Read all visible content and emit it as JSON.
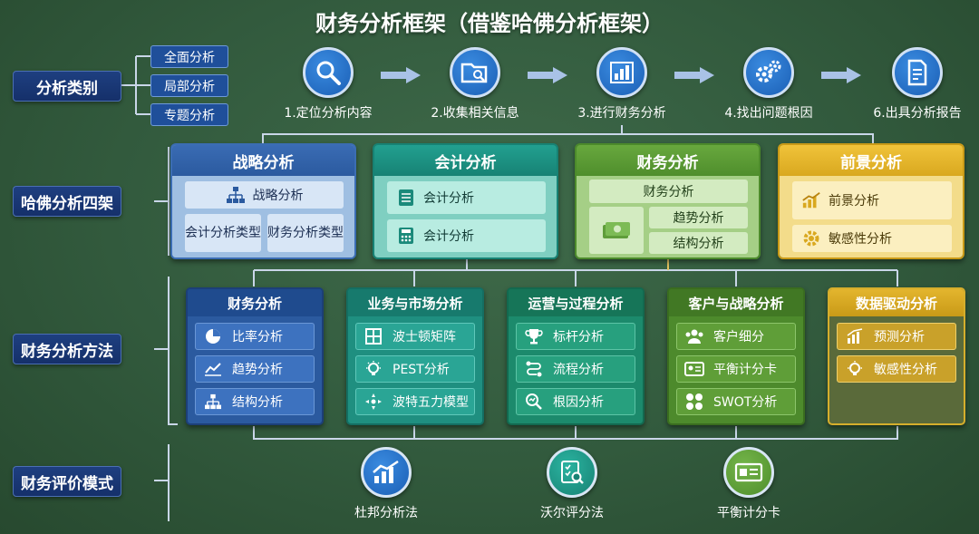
{
  "title": "财务分析框架（借鉴哈佛分析框架）",
  "categories": {
    "analysis_type": "分析类别",
    "harvard": "哈佛分析四架",
    "methods": "财务分析方法",
    "evaluation": "财务评价模式"
  },
  "analysis_types": [
    "全面分析",
    "局部分析",
    "专题分析"
  ],
  "steps": [
    {
      "label": "1.定位分析内容",
      "icon": "search-icon"
    },
    {
      "label": "2.收集相关信息",
      "icon": "folder-search-icon"
    },
    {
      "label": "3.进行财务分析",
      "icon": "bar-chart-icon"
    },
    {
      "label": "4.找出问题根因",
      "icon": "gears-icon"
    },
    {
      "label": "6.出具分析报告",
      "icon": "report-icon"
    }
  ],
  "frameworks": {
    "strategy": {
      "title": "战略分析",
      "main": "战略分析",
      "left": "会计分析类型",
      "right": "财务分析类型"
    },
    "accounting": {
      "title": "会计分析",
      "items": [
        "会计分析",
        "会计分析"
      ]
    },
    "financial": {
      "title": "财务分析",
      "main": "财务分析",
      "items": [
        "趋势分析",
        "结构分析"
      ]
    },
    "prospect": {
      "title": "前景分析",
      "items": [
        "前景分析",
        "敏感性分析"
      ]
    }
  },
  "methods": [
    {
      "title": "财务分析",
      "items": [
        {
          "label": "比率分析",
          "icon": "pie-icon"
        },
        {
          "label": "趋势分析",
          "icon": "trend-icon"
        },
        {
          "label": "结构分析",
          "icon": "org-icon"
        }
      ]
    },
    {
      "title": "业务与市场分析",
      "items": [
        {
          "label": "波士顿矩阵",
          "icon": "matrix-icon"
        },
        {
          "label": "PEST分析",
          "icon": "bulb-icon"
        },
        {
          "label": "波特五力模型",
          "icon": "forces-icon"
        }
      ]
    },
    {
      "title": "运营与过程分析",
      "items": [
        {
          "label": "标杆分析",
          "icon": "trophy-icon"
        },
        {
          "label": "流程分析",
          "icon": "flow-icon"
        },
        {
          "label": "根因分析",
          "icon": "magnify-icon"
        }
      ]
    },
    {
      "title": "客户与战略分析",
      "items": [
        {
          "label": "客户细分",
          "icon": "users-icon"
        },
        {
          "label": "平衡计分卡",
          "icon": "card-icon"
        },
        {
          "label": "SWOT分析",
          "icon": "swot-icon"
        }
      ]
    },
    {
      "title": "数据驱动分析",
      "items": [
        {
          "label": "预测分析",
          "icon": "forecast-icon"
        },
        {
          "label": "敏感性分析",
          "icon": "bulb-icon"
        }
      ]
    }
  ],
  "evaluation": [
    {
      "label": "杜邦分析法",
      "icon": "growth-chart-icon"
    },
    {
      "label": "沃尔评分法",
      "icon": "checklist-icon"
    },
    {
      "label": "平衡计分卡",
      "icon": "id-card-icon"
    }
  ],
  "colors": {
    "blue": "#2c5fa8",
    "teal": "#1f9a8a",
    "green": "#5d9a38",
    "gold": "#e6b82d"
  }
}
